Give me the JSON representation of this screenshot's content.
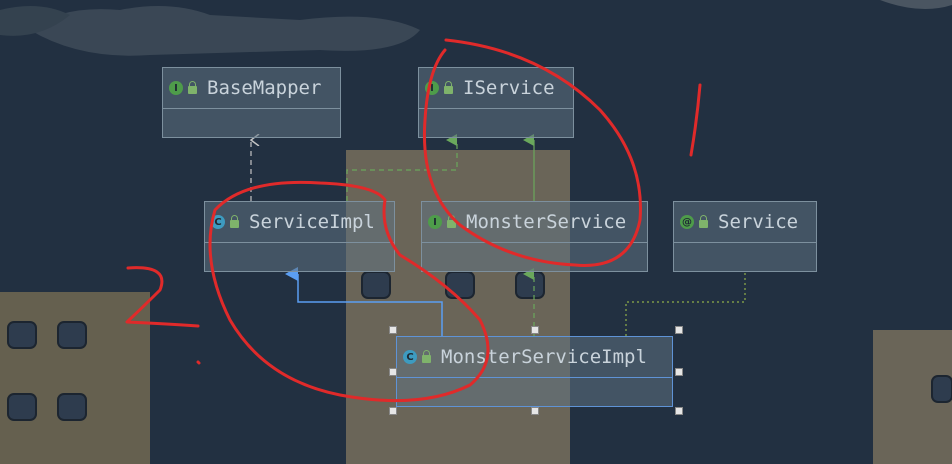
{
  "colors": {
    "interface_icon": "#4e9c4a",
    "class_icon": "#3d9bc0",
    "annotation_icon": "#4e9c4a",
    "implements_edge": "#6aa85c",
    "extends_edge": "#5b9ef2",
    "dependency_edge": "#c4c4c4",
    "annotation_edge": "#8fae4a",
    "red_annotation": "#e02a2a"
  },
  "nodes": [
    {
      "id": "base-mapper",
      "label": "BaseMapper",
      "kind": "interface",
      "kind_glyph": "I"
    },
    {
      "id": "iservice",
      "label": "IService",
      "kind": "interface",
      "kind_glyph": "I"
    },
    {
      "id": "service-impl",
      "label": "ServiceImpl",
      "kind": "class",
      "kind_glyph": "C"
    },
    {
      "id": "monster-service",
      "label": "MonsterService",
      "kind": "interface",
      "kind_glyph": "I"
    },
    {
      "id": "service",
      "label": "Service",
      "kind": "annotation",
      "kind_glyph": "@"
    },
    {
      "id": "monster-service-impl",
      "label": "MonsterServiceImpl",
      "kind": "class",
      "kind_glyph": "C",
      "selected": true
    }
  ],
  "edges": [
    {
      "from": "service-impl",
      "to": "base-mapper",
      "type": "dependency"
    },
    {
      "from": "service-impl",
      "to": "iservice",
      "type": "implements"
    },
    {
      "from": "monster-service",
      "to": "iservice",
      "type": "extends-interface"
    },
    {
      "from": "monster-service-impl",
      "to": "service-impl",
      "type": "extends"
    },
    {
      "from": "monster-service-impl",
      "to": "monster-service",
      "type": "implements"
    },
    {
      "from": "monster-service-impl",
      "to": "service",
      "type": "annotated"
    }
  ],
  "annotations": [
    {
      "text": "1",
      "color": "#e02a2a"
    },
    {
      "text": "2",
      "color": "#e02a2a"
    }
  ]
}
